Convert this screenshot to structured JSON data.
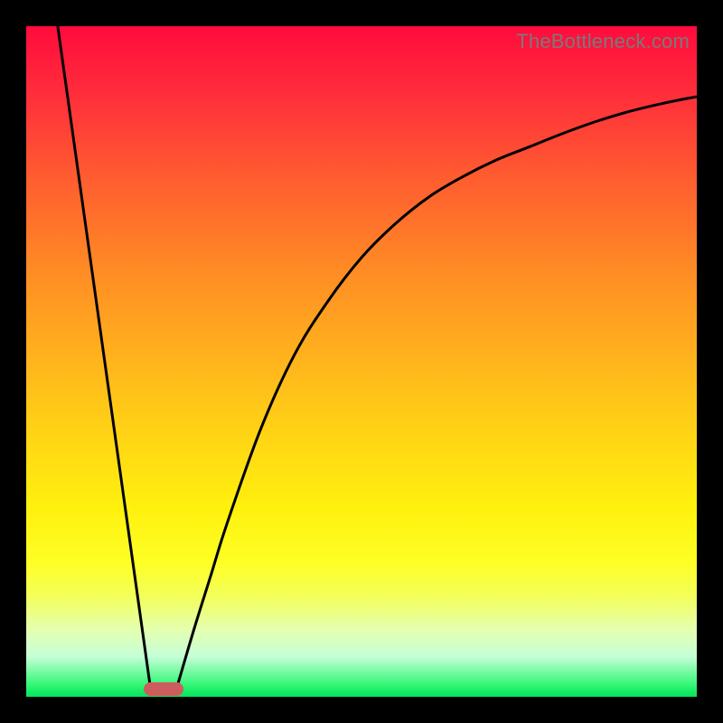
{
  "watermark": "TheBottleneck.com",
  "colors": {
    "frame": "#000000",
    "curve": "#000000",
    "marker": "#cd5d5d",
    "gradient_top": "#ff0b3d",
    "gradient_bottom": "#00e65a"
  },
  "chart_data": {
    "type": "line",
    "title": "",
    "xlabel": "",
    "ylabel": "",
    "xlim": [
      0,
      100
    ],
    "ylim": [
      0,
      100
    ],
    "grid": false,
    "legend": false,
    "series": [
      {
        "name": "left-line",
        "x": [
          4.7,
          18.5
        ],
        "y": [
          100,
          1.5
        ]
      },
      {
        "name": "right-curve",
        "x": [
          22.5,
          25,
          27.5,
          30,
          35,
          40,
          45,
          50,
          55,
          60,
          65,
          70,
          75,
          80,
          85,
          90,
          95,
          100
        ],
        "y": [
          1.5,
          10,
          18,
          26,
          40,
          51,
          59,
          65.5,
          70.5,
          74.5,
          77.5,
          80,
          82,
          84,
          85.8,
          87.3,
          88.5,
          89.5
        ]
      }
    ],
    "marker": {
      "center_x": 20.5,
      "y": 1.2,
      "width": 6,
      "height": 2
    }
  }
}
